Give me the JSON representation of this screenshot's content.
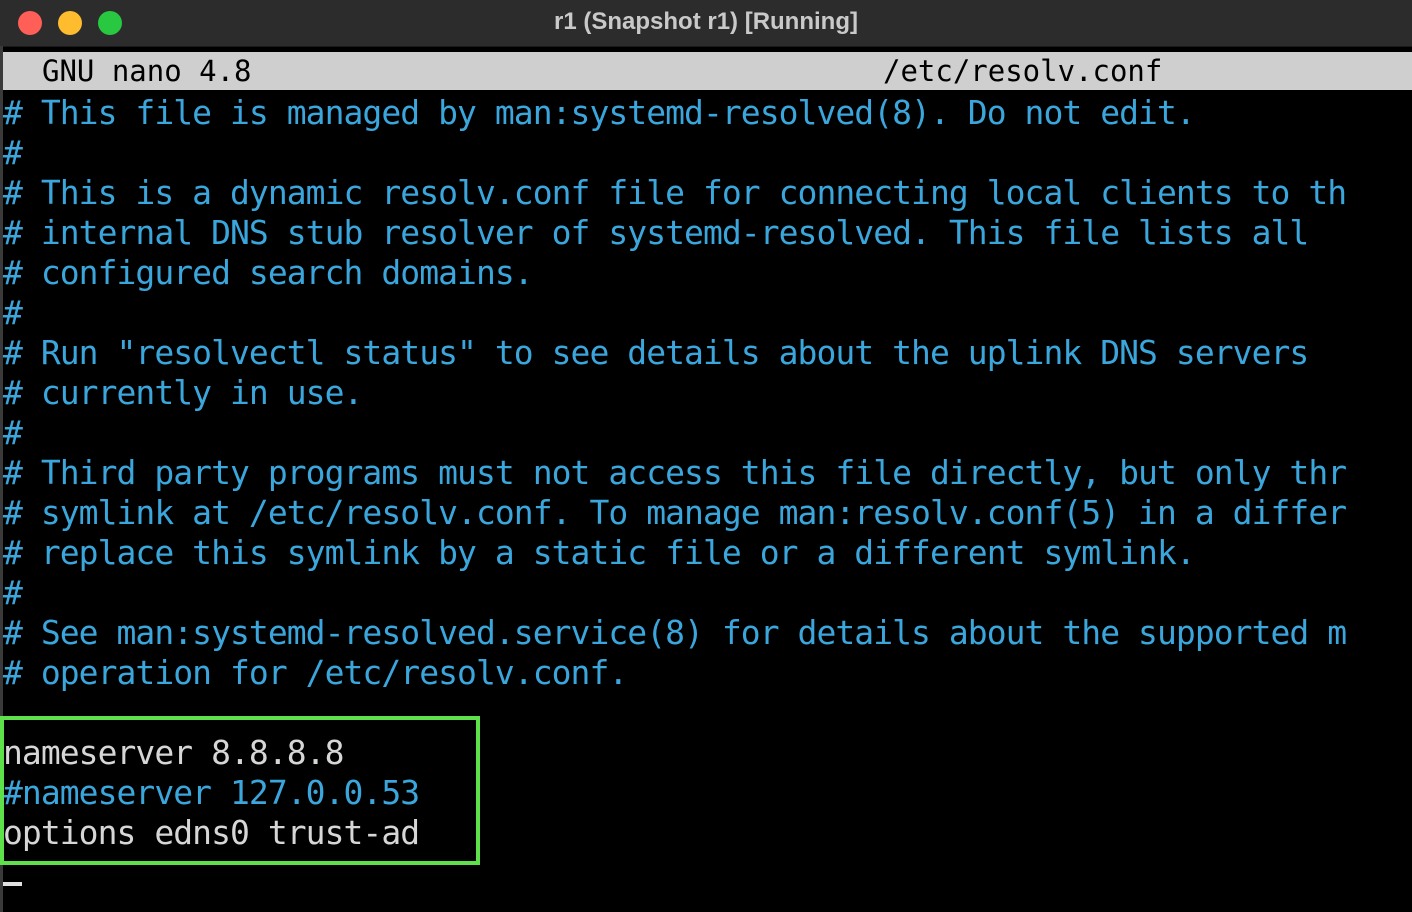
{
  "window": {
    "title": "r1 (Snapshot r1) [Running]"
  },
  "nano": {
    "version": "GNU nano 4.8",
    "filename": "/etc/resolv.conf"
  },
  "buffer": {
    "lines": [
      "# This file is managed by man:systemd-resolved(8). Do not edit.",
      "#",
      "# This is a dynamic resolv.conf file for connecting local clients to th",
      "# internal DNS stub resolver of systemd-resolved. This file lists all",
      "# configured search domains.",
      "#",
      "# Run \"resolvectl status\" to see details about the uplink DNS servers",
      "# currently in use.",
      "#",
      "# Third party programs must not access this file directly, but only thr",
      "# symlink at /etc/resolv.conf. To manage man:resolv.conf(5) in a differ",
      "# replace this symlink by a static file or a different symlink.",
      "#",
      "# See man:systemd-resolved.service(8) for details about the supported m",
      "# operation for /etc/resolv.conf.",
      "",
      "nameserver 8.8.8.8",
      "#nameserver 127.0.0.53",
      "options edns0 trust-ad"
    ]
  },
  "colors": {
    "comment": "#3aa6dc",
    "plain_text": "#d6d6d6",
    "highlight_box": "#5ee04a",
    "header_bg": "#cfcfcf"
  }
}
